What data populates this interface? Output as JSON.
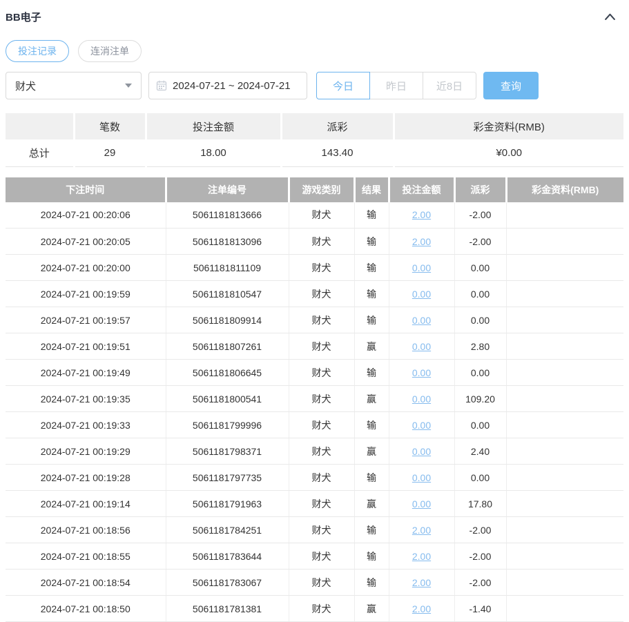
{
  "panel": {
    "title": "BB电子",
    "collapse_icon": "chevron-up"
  },
  "tabs": [
    {
      "label": "投注记录",
      "active": true
    },
    {
      "label": "连消注单",
      "active": false
    }
  ],
  "filters": {
    "game_select": {
      "value": "财犬",
      "icon": "caret-down"
    },
    "date_range": {
      "value": "2024-07-21 ~ 2024-07-21",
      "icon": "calendar"
    },
    "quick_ranges": [
      {
        "label": "今日",
        "active": true
      },
      {
        "label": "昨日",
        "active": false
      },
      {
        "label": "近8日",
        "active": false
      }
    ],
    "search_label": "查询"
  },
  "summary": {
    "headers": [
      "",
      "笔数",
      "投注金额",
      "派彩",
      "彩金资料(RMB)"
    ],
    "row_label": "总计",
    "count": "29",
    "bet_amount": "18.00",
    "payout": "143.40",
    "bonus": "¥0.00"
  },
  "bet_table": {
    "headers": [
      "下注时间",
      "注单编号",
      "游戏类别",
      "结果",
      "投注金额",
      "派彩",
      "彩金资料(RMB)"
    ],
    "rows": [
      {
        "time": "2024-07-21 00:20:06",
        "bet_id": "5061181813666",
        "game": "财犬",
        "result": "输",
        "amount": "2.00",
        "payout": "-2.00",
        "bonus": ""
      },
      {
        "time": "2024-07-21 00:20:05",
        "bet_id": "5061181813096",
        "game": "财犬",
        "result": "输",
        "amount": "2.00",
        "payout": "-2.00",
        "bonus": ""
      },
      {
        "time": "2024-07-21 00:20:00",
        "bet_id": "5061181811109",
        "game": "财犬",
        "result": "输",
        "amount": "0.00",
        "payout": "0.00",
        "bonus": ""
      },
      {
        "time": "2024-07-21 00:19:59",
        "bet_id": "5061181810547",
        "game": "财犬",
        "result": "输",
        "amount": "0.00",
        "payout": "0.00",
        "bonus": ""
      },
      {
        "time": "2024-07-21 00:19:57",
        "bet_id": "5061181809914",
        "game": "财犬",
        "result": "输",
        "amount": "0.00",
        "payout": "0.00",
        "bonus": ""
      },
      {
        "time": "2024-07-21 00:19:51",
        "bet_id": "5061181807261",
        "game": "财犬",
        "result": "赢",
        "amount": "0.00",
        "payout": "2.80",
        "bonus": ""
      },
      {
        "time": "2024-07-21 00:19:49",
        "bet_id": "5061181806645",
        "game": "财犬",
        "result": "输",
        "amount": "0.00",
        "payout": "0.00",
        "bonus": ""
      },
      {
        "time": "2024-07-21 00:19:35",
        "bet_id": "5061181800541",
        "game": "财犬",
        "result": "赢",
        "amount": "0.00",
        "payout": "109.20",
        "bonus": ""
      },
      {
        "time": "2024-07-21 00:19:33",
        "bet_id": "5061181799996",
        "game": "财犬",
        "result": "输",
        "amount": "0.00",
        "payout": "0.00",
        "bonus": ""
      },
      {
        "time": "2024-07-21 00:19:29",
        "bet_id": "5061181798371",
        "game": "财犬",
        "result": "赢",
        "amount": "0.00",
        "payout": "2.40",
        "bonus": ""
      },
      {
        "time": "2024-07-21 00:19:28",
        "bet_id": "5061181797735",
        "game": "财犬",
        "result": "输",
        "amount": "0.00",
        "payout": "0.00",
        "bonus": ""
      },
      {
        "time": "2024-07-21 00:19:14",
        "bet_id": "5061181791963",
        "game": "财犬",
        "result": "赢",
        "amount": "0.00",
        "payout": "17.80",
        "bonus": ""
      },
      {
        "time": "2024-07-21 00:18:56",
        "bet_id": "5061181784251",
        "game": "财犬",
        "result": "输",
        "amount": "2.00",
        "payout": "-2.00",
        "bonus": ""
      },
      {
        "time": "2024-07-21 00:18:55",
        "bet_id": "5061181783644",
        "game": "财犬",
        "result": "输",
        "amount": "2.00",
        "payout": "-2.00",
        "bonus": ""
      },
      {
        "time": "2024-07-21 00:18:54",
        "bet_id": "5061181783067",
        "game": "财犬",
        "result": "输",
        "amount": "2.00",
        "payout": "-2.00",
        "bonus": ""
      },
      {
        "time": "2024-07-21 00:18:50",
        "bet_id": "5061181781381",
        "game": "财犬",
        "result": "赢",
        "amount": "2.00",
        "payout": "-1.40",
        "bonus": ""
      }
    ]
  },
  "colors": {
    "accent_blue": "#6cb3ee",
    "query_button_bg": "#6fb9f1",
    "link_blue": "#85bbee",
    "negative_red": "#e05c64",
    "table_header_bg": "#b2b2b2",
    "summary_header_bg": "#f0f0f0"
  }
}
